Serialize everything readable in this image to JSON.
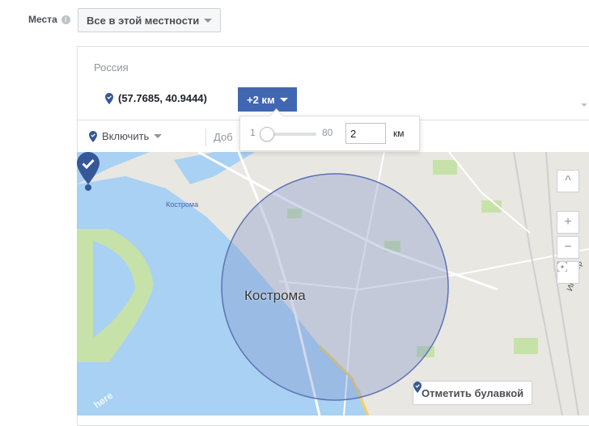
{
  "places": {
    "label": "Места",
    "info_icon": "info-icon",
    "scope_value": "Все в этой местности"
  },
  "location": {
    "country": "Россия",
    "coords": "(57.7685, 40.9444)",
    "radius_label": "+2 км"
  },
  "toolbar": {
    "include_label": "Включить",
    "add_placeholder": "Доб"
  },
  "radius_popup": {
    "min": "1",
    "max": "80",
    "value": "2",
    "unit": "км",
    "slider_fraction": 0.025
  },
  "map": {
    "city_label": "Кострома",
    "city_label_small": "Кострома",
    "street_label": "Индустр",
    "watermark": "here",
    "pin_button_label": "Отметить булавкой",
    "controls": {
      "up": "^",
      "zoom_in": "+",
      "zoom_out": "−"
    }
  },
  "colors": {
    "accent": "#4267b2",
    "pin": "#365899",
    "water": "#a8d1f3",
    "radius_fill": "#7e93c8"
  }
}
